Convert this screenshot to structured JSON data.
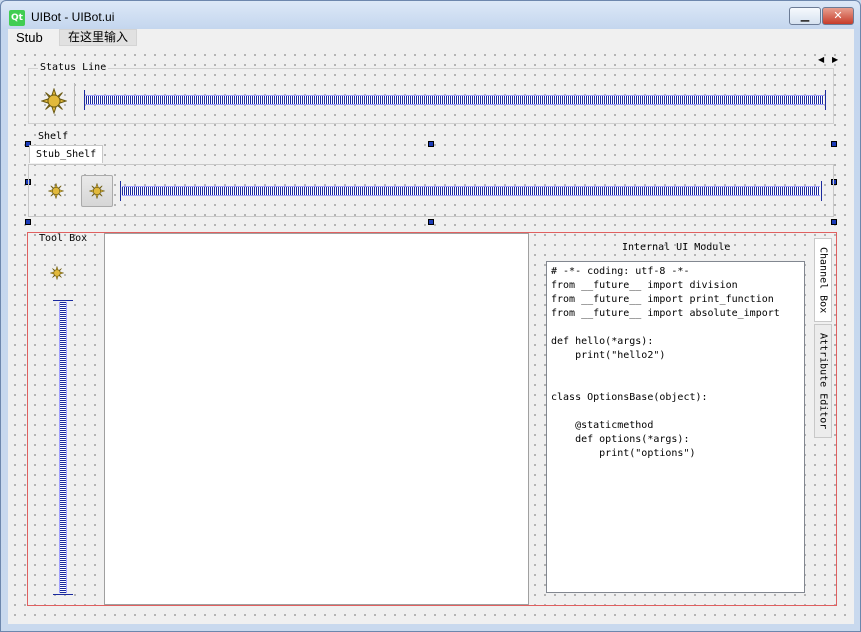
{
  "window": {
    "title": "UIBot - UIBot.ui",
    "logo_text": "Qt",
    "minimize_glyph": "▁",
    "close_glyph": "✕"
  },
  "menubar": {
    "items": [
      "Stub"
    ],
    "type_here": "在这里输入"
  },
  "status_line": {
    "label": "Status Line",
    "icon": "sun-icon"
  },
  "shelf": {
    "label": "Shelf",
    "tab": "Stub_Shelf",
    "icons": [
      "sun-icon",
      "sun-icon"
    ]
  },
  "toolbox": {
    "label": "Tool Box",
    "icon": "sun-icon"
  },
  "module": {
    "title": "Internal UI Module",
    "code": "# -*- coding: utf-8 -*-\nfrom __future__ import division\nfrom __future__ import print_function\nfrom __future__ import absolute_import\n\ndef hello(*args):\n    print(\"hello2\")\n\n\nclass OptionsBase(object):\n\n    @staticmethod\n    def options(*args):\n        print(\"options\")"
  },
  "side_tabs": {
    "channel_box": "Channel Box",
    "attribute_editor": "Attribute Editor"
  },
  "scroll_arrows": {
    "left": "◀",
    "right": "▶"
  },
  "colors": {
    "accent_blue": "#1b2a9e",
    "selection_red": "#e06060",
    "sun_yellow": "#e2b93b"
  }
}
